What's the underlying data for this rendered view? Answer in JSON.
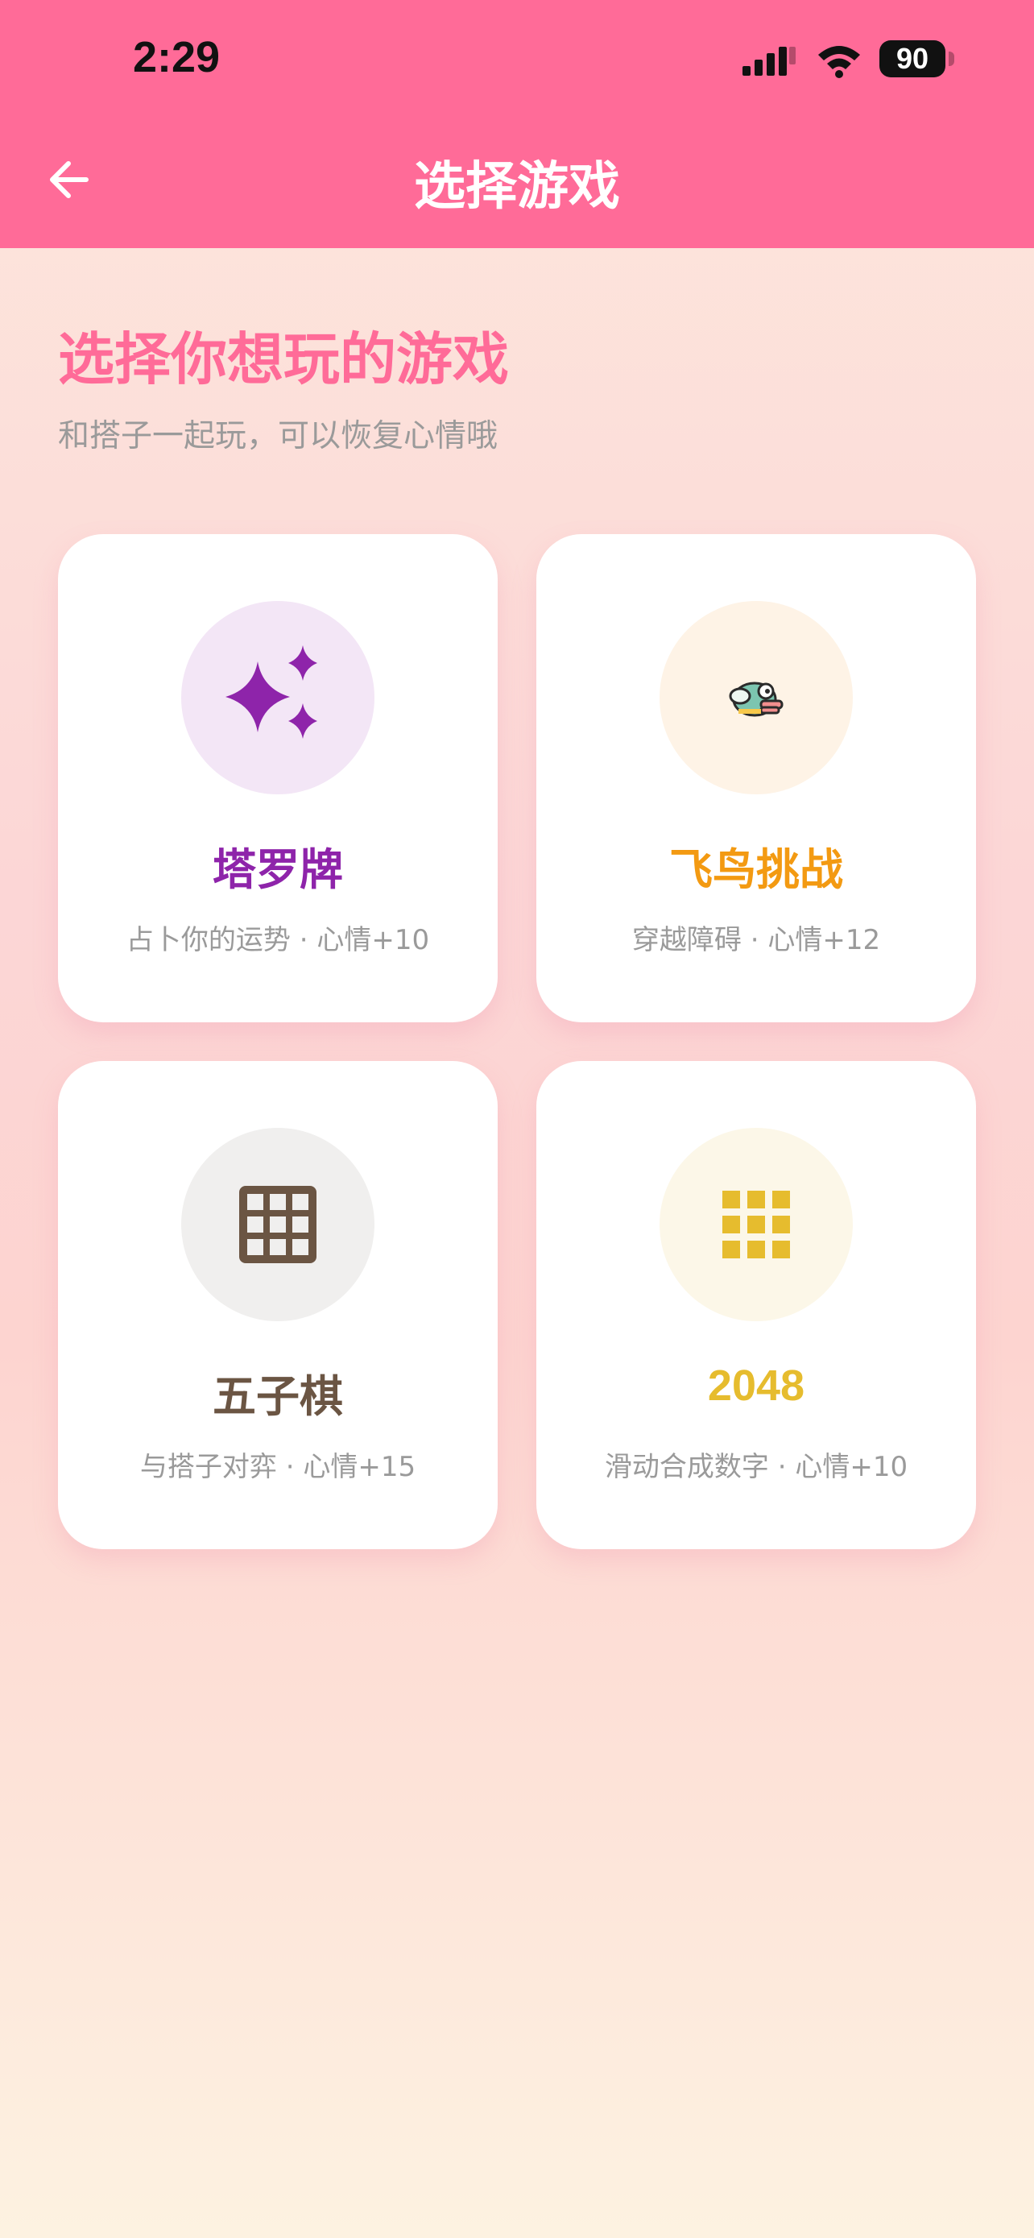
{
  "status": {
    "time": "2:29",
    "battery": "90"
  },
  "header": {
    "title": "选择游戏"
  },
  "page": {
    "title": "选择你想玩的游戏",
    "subtitle": "和搭子一起玩，可以恢复心情哦"
  },
  "games": [
    {
      "name": "塔罗牌",
      "desc": "占卜你的运势 · 心情+10",
      "icon": "sparkles-icon",
      "color": "#8e24aa",
      "bg": "#f3e6f6"
    },
    {
      "name": "飞鸟挑战",
      "desc": "穿越障碍 · 心情+12",
      "icon": "bird-icon",
      "color": "#f39a12",
      "bg": "#fef3e6"
    },
    {
      "name": "五子棋",
      "desc": "与搭子对弈 · 心情+15",
      "icon": "grid-icon",
      "color": "#6b5543",
      "bg": "#f0efee"
    },
    {
      "name": "2048",
      "desc": "滑动合成数字 · 心情+10",
      "icon": "apps-grid-icon",
      "color": "#e6bc2e",
      "bg": "#fcf7e8"
    }
  ],
  "colors": {
    "header": "#ff6b98",
    "title": "#ff6b98"
  }
}
